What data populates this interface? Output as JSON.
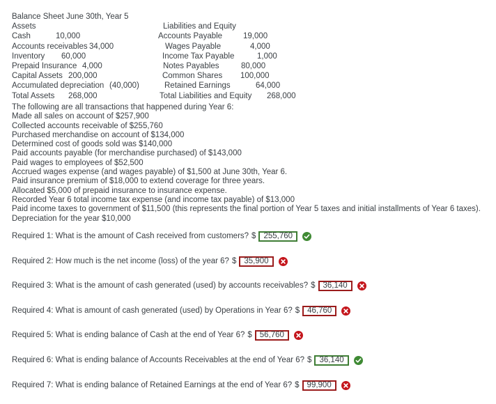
{
  "balance_sheet": {
    "title": "Balance Sheet June 30th, Year 5",
    "left_heading": "Assets",
    "right_heading": "Liabilities and Equity",
    "left_rows": [
      {
        "label": "Cash",
        "amount": "10,000",
        "label_pad": "Cash                     ",
        "indent": 0
      },
      {
        "label": "Accounts receivables",
        "amount": "34,000",
        "indent": 0
      },
      {
        "label": "Inventory",
        "amount": "60,000",
        "indent": 0
      },
      {
        "label": "Prepaid Insurance",
        "amount": "4,000",
        "indent": 0
      },
      {
        "label": "Capital Assets",
        "amount": "200,000",
        "indent": 0
      },
      {
        "label": "Accumulated depreciation",
        "amount": "(40,000)",
        "indent": 0
      },
      {
        "label": "Total Assets",
        "amount": "268,000",
        "indent": 0
      }
    ],
    "left_amount_offsets": [
      63,
      111,
      71,
      101,
      81,
      140,
      81
    ],
    "right_rows": [
      {
        "label": "Accounts Payable",
        "amount": "19,000",
        "indent": 3
      },
      {
        "label": "Wages Payable",
        "amount": "4,000",
        "indent": 13
      },
      {
        "label": "Income Tax Payable",
        "amount": "1,000",
        "indent": 9
      },
      {
        "label": "Notes Payables",
        "amount": "80,000",
        "indent": 10
      },
      {
        "label": "Common Shares",
        "amount": "100,000",
        "indent": 9
      },
      {
        "label": "Retained Earnings",
        "amount": "64,000",
        "indent": 12
      },
      {
        "label": "Total Liabilities and Equity",
        "amount": "268,000",
        "indent": 5
      }
    ],
    "right_amount_offsets": [
      122,
      122,
      136,
      112,
      112,
      131,
      154
    ],
    "right_heading_indent": 10
  },
  "transactions": {
    "intro": "The following are all transactions that happened during Year 6:",
    "items": [
      "Made all sales on account of $257,900",
      "Collected accounts receivable of $255,760",
      "Purchased merchandise on account of $134,000",
      "Determined cost of goods sold was $140,000",
      "Paid accounts payable (for merchandise purchased) of $143,000",
      "Paid wages to employees of $52,500",
      "Accrued wages expense (and wages payable) of $1,500 at June 30th, Year 6.",
      "Paid insurance premium of $18,000 to extend coverage for three years.",
      "Allocated $5,000 of prepaid insurance to insurance expense.",
      "Recorded Year 6 total income tax expense (and income tax payable) of $13,000",
      "Paid income taxes to government of $11,500 (this represents the final portion of Year 5 taxes and initial installments of Year 6 taxes).",
      "Depreciation for the year $10,000"
    ]
  },
  "questions": [
    {
      "text": "Required 1: What is the amount of Cash received from customers?",
      "dollar": "$",
      "value": "255,760",
      "status": "correct",
      "status_icon": "check-circle-icon"
    },
    {
      "text": "Required 2: How much is the net income (loss) of the year 6?",
      "dollar": "$",
      "value": "35,900",
      "status": "incorrect",
      "status_icon": "x-circle-icon"
    },
    {
      "text": "Required 3: What is the amount of cash generated (used) by accounts receivables?",
      "dollar": "$",
      "value": "36,140",
      "status": "incorrect",
      "status_icon": "x-circle-icon"
    },
    {
      "text": "Required 4: What is amount of cash generated (used) by Operations in Year 6?",
      "dollar": "$",
      "value": "46,760",
      "status": "incorrect",
      "status_icon": "x-circle-icon"
    },
    {
      "text": "Required 5: What is ending balance of Cash at the end of Year 6?",
      "dollar": "$",
      "value": "56,760",
      "status": "incorrect",
      "status_icon": "x-circle-icon"
    },
    {
      "text": "Required 6: What is ending balance of Accounts Receivables at the end of Year 6?",
      "dollar": "$",
      "value": "36,140",
      "status": "correct",
      "status_icon": "check-circle-icon"
    },
    {
      "text": "Required 7: What is ending balance of Retained Earnings at the end of Year 6?",
      "dollar": "$",
      "value": "99,900",
      "status": "incorrect",
      "status_icon": "x-circle-icon"
    }
  ],
  "colors": {
    "text": "#3b4045",
    "correct_border": "#3f7d35",
    "correct_icon": "#3f8a34",
    "incorrect_border": "#9b1c1c",
    "incorrect_icon": "#c4161c",
    "background": "#ffffff"
  }
}
